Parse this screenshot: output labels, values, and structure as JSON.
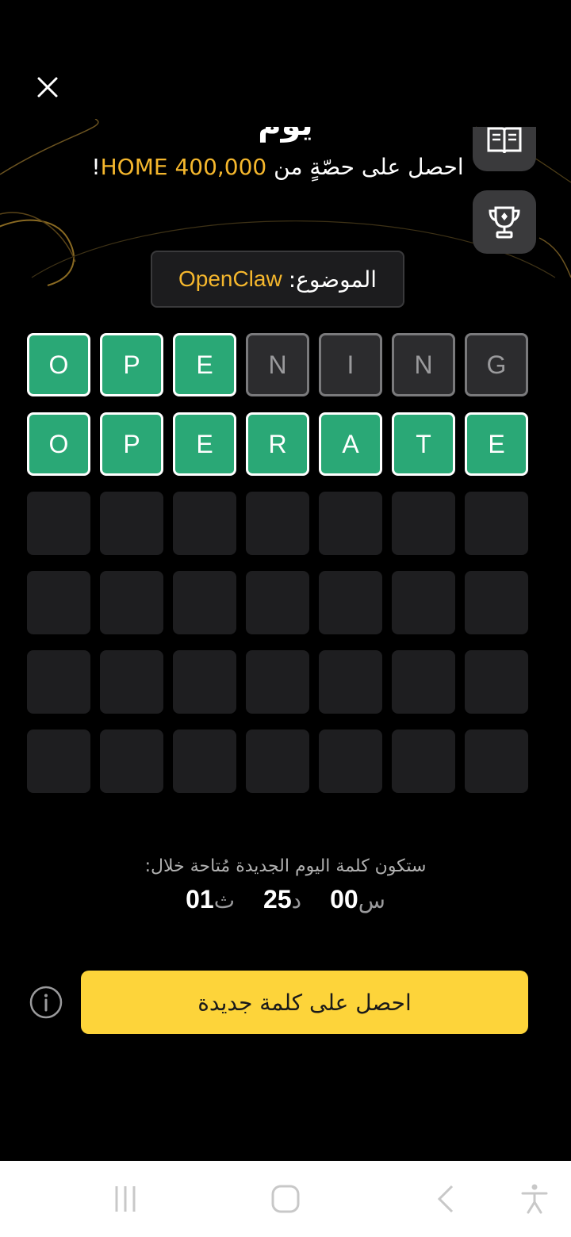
{
  "header": {
    "truncated_title": "يوم",
    "prize_prefix": "احصل على حصّةٍ من ",
    "prize_amount": "HOME 400,000",
    "prize_suffix": "!"
  },
  "icons": {
    "close": "close-icon",
    "rules": "book-icon",
    "leaderboard": "trophy-icon",
    "info": "info-icon"
  },
  "topic": {
    "label": "الموضوع:",
    "value": "OpenClaw"
  },
  "grid": {
    "rows": [
      [
        {
          "letter": "O",
          "state": "correct"
        },
        {
          "letter": "P",
          "state": "correct"
        },
        {
          "letter": "E",
          "state": "correct"
        },
        {
          "letter": "N",
          "state": "absent"
        },
        {
          "letter": "I",
          "state": "absent"
        },
        {
          "letter": "N",
          "state": "absent"
        },
        {
          "letter": "G",
          "state": "absent"
        }
      ],
      [
        {
          "letter": "O",
          "state": "correct"
        },
        {
          "letter": "P",
          "state": "correct"
        },
        {
          "letter": "E",
          "state": "correct"
        },
        {
          "letter": "R",
          "state": "correct"
        },
        {
          "letter": "A",
          "state": "correct"
        },
        {
          "letter": "T",
          "state": "correct"
        },
        {
          "letter": "E",
          "state": "correct"
        }
      ],
      [
        {
          "letter": "",
          "state": "empty"
        },
        {
          "letter": "",
          "state": "empty"
        },
        {
          "letter": "",
          "state": "empty"
        },
        {
          "letter": "",
          "state": "empty"
        },
        {
          "letter": "",
          "state": "empty"
        },
        {
          "letter": "",
          "state": "empty"
        },
        {
          "letter": "",
          "state": "empty"
        }
      ],
      [
        {
          "letter": "",
          "state": "empty"
        },
        {
          "letter": "",
          "state": "empty"
        },
        {
          "letter": "",
          "state": "empty"
        },
        {
          "letter": "",
          "state": "empty"
        },
        {
          "letter": "",
          "state": "empty"
        },
        {
          "letter": "",
          "state": "empty"
        },
        {
          "letter": "",
          "state": "empty"
        }
      ],
      [
        {
          "letter": "",
          "state": "empty"
        },
        {
          "letter": "",
          "state": "empty"
        },
        {
          "letter": "",
          "state": "empty"
        },
        {
          "letter": "",
          "state": "empty"
        },
        {
          "letter": "",
          "state": "empty"
        },
        {
          "letter": "",
          "state": "empty"
        },
        {
          "letter": "",
          "state": "empty"
        }
      ],
      [
        {
          "letter": "",
          "state": "empty"
        },
        {
          "letter": "",
          "state": "empty"
        },
        {
          "letter": "",
          "state": "empty"
        },
        {
          "letter": "",
          "state": "empty"
        },
        {
          "letter": "",
          "state": "empty"
        },
        {
          "letter": "",
          "state": "empty"
        },
        {
          "letter": "",
          "state": "empty"
        }
      ]
    ]
  },
  "countdown": {
    "label": "ستكون كلمة اليوم الجديدة مُتاحة خلال:",
    "hours": "00",
    "hours_suffix": "س",
    "minutes": "25",
    "minutes_suffix": "د",
    "seconds": "01",
    "seconds_suffix": "ث"
  },
  "cta": {
    "label": "احصل على كلمة جديدة"
  },
  "navbar": {
    "recents": "recents-icon",
    "home": "home-icon",
    "back": "back-icon",
    "accessibility": "accessibility-icon"
  },
  "colors": {
    "background": "#000000",
    "accent_gold": "#f5b72d",
    "cta_yellow": "#fdd43a",
    "correct_green": "#2aa876",
    "absent_gray": "#2c2c2e",
    "empty_tile": "#1e1e20"
  }
}
